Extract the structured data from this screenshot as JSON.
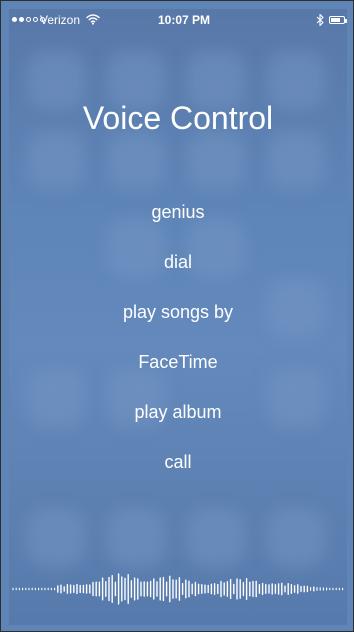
{
  "status_bar": {
    "signal_strength": 2,
    "signal_total": 5,
    "carrier": "Verizon",
    "wifi_icon": "wifi-icon",
    "time": "10:07 PM",
    "bluetooth_icon": "bluetooth-icon",
    "battery_icon": "battery-icon",
    "battery_fraction": 0.75
  },
  "voice_control": {
    "title": "Voice Control",
    "commands": [
      "genius",
      "dial",
      "play songs by",
      "FaceTime",
      "play album",
      "call"
    ],
    "waveform_icon": "audio-waveform-icon"
  },
  "colors": {
    "background": "#5f86b8",
    "text": "#ffffff"
  }
}
